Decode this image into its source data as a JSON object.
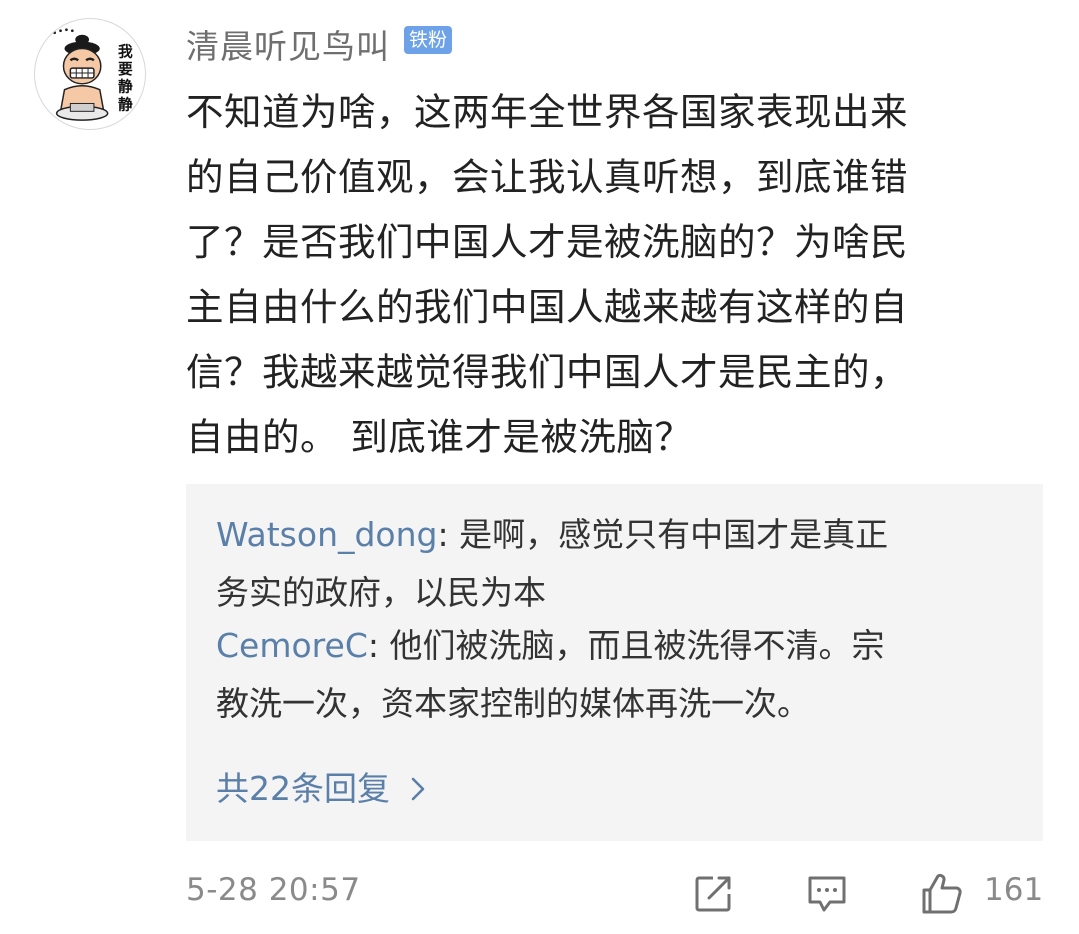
{
  "comment": {
    "avatar_text": "我要静静",
    "username": "清晨听见鸟叫",
    "badge": "铁粉",
    "lines": [
      "不知道为啥，这两年全世界各国家表现出来",
      "的自己价值观，会让我认真听想，到底谁错",
      "了？是否我们中国人才是被洗脑的？为啥民",
      "主自由什么的我们中国人越来越有这样的自",
      "信？我越来越觉得我们中国人才是民主的，",
      "自由的。 到底谁才是被洗脑？"
    ],
    "timestamp": "5-28 20:57",
    "like_count": "161"
  },
  "replies": [
    {
      "user": "Watson_dong",
      "separator": ":",
      "line1": " 是啊，感觉只有中国才是真正",
      "line2": "务实的政府，以民为本"
    },
    {
      "user": "CemoreC",
      "separator": ":",
      "line1": " 他们被洗脑，而且被洗得不清。宗",
      "line2": "教洗一次，资本家控制的媒体再洗一次。"
    }
  ],
  "more_replies": "共22条回复",
  "colors": {
    "username": "#6f6f6f",
    "badge_bg": "#6da2e8",
    "body_text": "#222222",
    "reply_user": "#5a7fa8",
    "reply_bg": "#f4f4f4",
    "meta": "#8a8a8a"
  },
  "icons": {
    "share": "share-edit-icon",
    "comment": "comment-bubble-icon",
    "like": "thumbs-up-icon",
    "more": "chevron-right-icon"
  }
}
